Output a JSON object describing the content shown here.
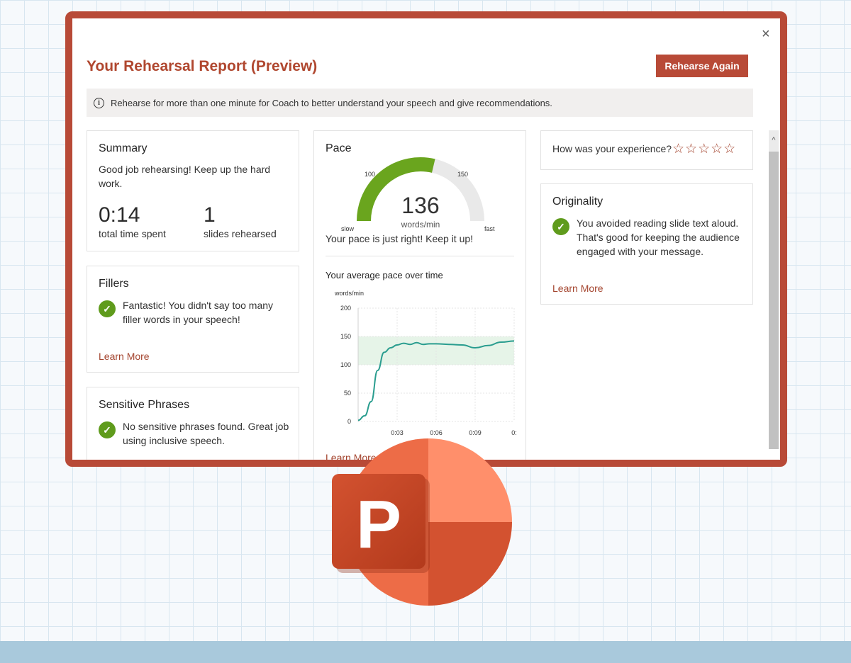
{
  "dialog": {
    "title": "Your Rehearsal Report (Preview)",
    "close_glyph": "×",
    "rehearse_again_label": "Rehearse Again",
    "info_glyph": "i",
    "info_text": "Rehearse for more than one minute for Coach to better understand your speech and give recommendations."
  },
  "summary": {
    "title": "Summary",
    "message": "Good job rehearsing! Keep up the hard work.",
    "time_value": "0:14",
    "time_label": "total time spent",
    "slides_value": "1",
    "slides_label": "slides rehearsed"
  },
  "fillers": {
    "title": "Fillers",
    "message": "Fantastic! You didn't say too many filler words in your speech!",
    "learn_more": "Learn More"
  },
  "sensitive": {
    "title": "Sensitive Phrases",
    "message": "No sensitive phrases found. Great job using inclusive speech."
  },
  "pace": {
    "title": "Pace",
    "value": "136",
    "unit": "words/min",
    "gauge_tick_100": "100",
    "gauge_tick_150": "150",
    "slow_label": "slow",
    "fast_label": "fast",
    "message": "Your pace is just right! Keep it up!",
    "chart_title": "Your average pace over time",
    "learn_more": "Learn More"
  },
  "chart_data": {
    "type": "line",
    "ylabel": "words/min",
    "ylim": [
      0,
      200
    ],
    "yticks": [
      "200",
      "150",
      "100",
      "50",
      "0"
    ],
    "xticks": [
      "0:03",
      "0:06",
      "0:09",
      "0:"
    ],
    "target_band": [
      100,
      150
    ],
    "series": [
      {
        "x": [
          0,
          0.5,
          1,
          1.5,
          2,
          2.5,
          3,
          3.5,
          4,
          4.5,
          5,
          5.5,
          6,
          7,
          8,
          9,
          10,
          11,
          12
        ],
        "values": [
          2,
          10,
          35,
          90,
          122,
          130,
          135,
          138,
          136,
          139,
          136,
          137,
          137,
          136,
          135,
          130,
          134,
          140,
          142
        ]
      }
    ],
    "line_color": "#2a9d8f",
    "band_color": "#e6f4e8"
  },
  "experience": {
    "question": "How was your experience?",
    "stars": "☆☆☆☆☆"
  },
  "originality": {
    "title": "Originality",
    "message": "You avoided reading slide text aloud. That's good for keeping the audience engaged with your message.",
    "learn_more": "Learn More"
  },
  "scrollbar": {
    "up_glyph": "^"
  },
  "logo": {
    "letter": "P"
  },
  "check_glyph": "✓",
  "colors": {
    "accent": "#b84a37",
    "success": "#5f9b1c",
    "gauge_green": "#6aa51e",
    "gauge_track": "#e9e9e9"
  }
}
